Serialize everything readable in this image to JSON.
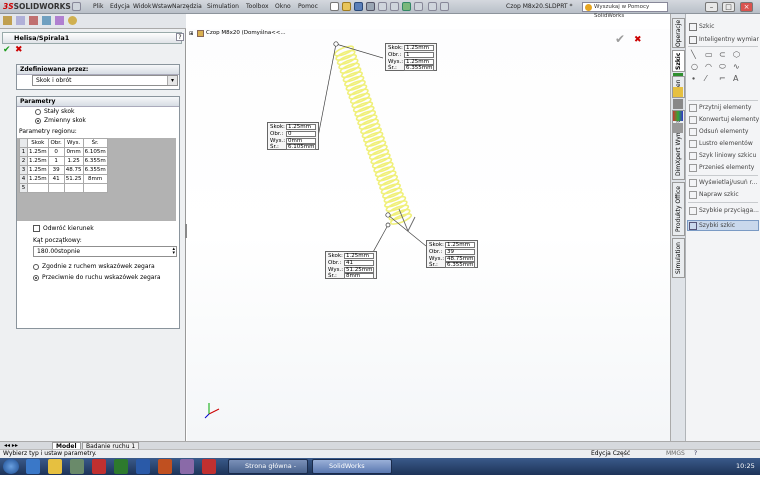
{
  "app": {
    "logo_brand": "SOLIDWORKS",
    "logo_prefix": "3S",
    "doc_title": "Czop M8x20.SLDPRT *",
    "search_placeholder": "Wyszukaj w Pomocy SolidWorks",
    "win_buttons": [
      "–",
      "□",
      "×"
    ]
  },
  "menu": [
    "Plik",
    "Edycja",
    "Widok",
    "Wstaw",
    "Narzędzia",
    "Simulation",
    "Toolbox",
    "Okno",
    "Pomoc"
  ],
  "pm": {
    "title": "Helisa/Spirala1",
    "ok_icon": "check-icon",
    "cancel_icon": "x-icon",
    "defined_group": {
      "title": "Zdefiniowana przez:",
      "value": "Skok i obrót"
    },
    "params_group": {
      "title": "Parametry",
      "constant_pitch": "Stały skok",
      "variable_pitch": "Zmienny skok",
      "region_label": "Parametry regionu:",
      "columns": [
        "Skok",
        "Obr.",
        "Wys.",
        "Śr."
      ],
      "rows": [
        [
          "1",
          "1.25m",
          "0",
          "0mm",
          "6.105m"
        ],
        [
          "2",
          "1.25m",
          "1",
          "1.25",
          "6.355m"
        ],
        [
          "3",
          "1.25m",
          "39",
          "48.75",
          "6.355m"
        ],
        [
          "4",
          "1.25m",
          "41",
          "51.25",
          "8mm"
        ],
        [
          "5",
          "",
          "",
          "",
          ""
        ]
      ],
      "reverse": "Odwróć kierunek",
      "start_angle_label": "Kąt początkowy:",
      "start_angle_value": "180.00stopnie",
      "cw": "Zgodnie z ruchem wskazówek zegara",
      "ccw": "Przeciwnie do ruchu wskazówek zegara"
    }
  },
  "viewport": {
    "tree_label": "Czop M8x20 (Domyślna<<...",
    "callouts": [
      {
        "skok": "1.25mm",
        "obr": "1",
        "wys": "1.25mm",
        "sr": "6.355mm"
      },
      {
        "skok": "1.25mm",
        "obr": "0",
        "wys": "0mm",
        "sr": "6.105mm"
      },
      {
        "skok": "1.25mm",
        "obr": "39",
        "wys": "48.75mm",
        "sr": "6.355mm"
      },
      {
        "skok": "1.25mm",
        "obr": "41",
        "wys": "51.25mm",
        "sr": "8mm"
      }
    ],
    "labels": {
      "skok": "Skok:",
      "obr": "Obr.:",
      "wys": "Wys.:",
      "sr": "Śr.:"
    },
    "helix_color": "#f0f07a"
  },
  "right_tabs": [
    "Operacje",
    "Szkic",
    "Ocen",
    "DimXpert Wymiarów",
    "Produkty Office",
    "Simulation"
  ],
  "right_panel": [
    "Szkic",
    "Inteligentny wymiar",
    "Przytnij elementy",
    "Konwertuj elementy",
    "Odsuń elementy",
    "Lustro elementów",
    "Szyk liniowy szkicu",
    "Przenieś elementy",
    "Wyświetlaj/usuń r...",
    "Napraw szkic",
    "Szybkie przyciąga...",
    "Szybki szkic"
  ],
  "bottom_tabs": [
    "Model",
    "Badanie ruchu 1"
  ],
  "status": {
    "left": "Wybierz typ i ustaw parametry.",
    "right": "Edycja Część",
    "mmgs": "MMGS",
    "help": "?"
  },
  "taskbar": {
    "items": [
      "Strona główna - PSW...",
      "SolidWorks Premium..."
    ],
    "clock": "10:25"
  }
}
